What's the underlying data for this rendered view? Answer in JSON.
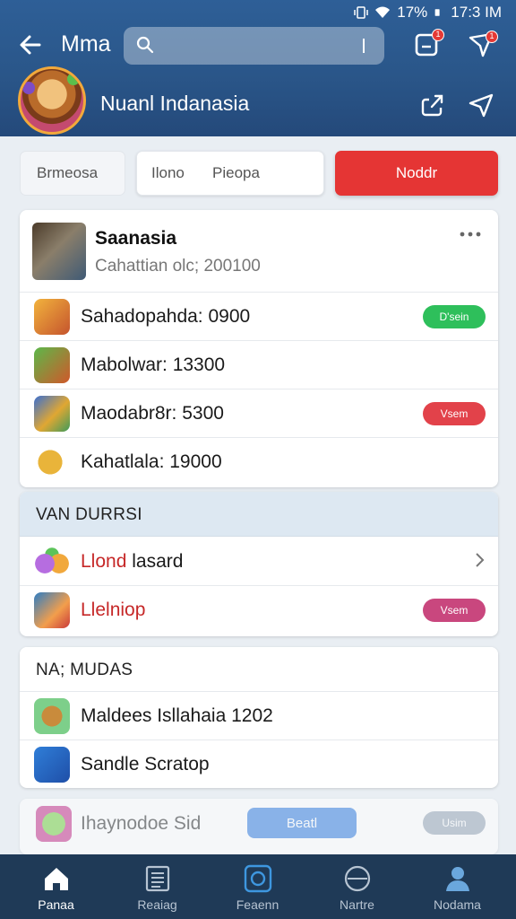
{
  "status_bar": {
    "battery": "17%",
    "time": "17:3 IM"
  },
  "header": {
    "title": "Mma",
    "search": {
      "value": "",
      "placeholder": ""
    },
    "notification_badge": "1",
    "send_badge": "1"
  },
  "profile": {
    "name": "Nuanl Indanasia"
  },
  "tabs": [
    {
      "label": "Brmeosa"
    },
    {
      "label_a": "Ilono",
      "label_b": "Pieopa"
    },
    {
      "label": "Noddr"
    }
  ],
  "feature": {
    "title": "Saanasia",
    "subtitle": "Cahattian olc; 200100"
  },
  "list_1": [
    {
      "text": "Sahadopahda: 0900",
      "pill": "D'sein",
      "pill_color": "#2ebf5b"
    },
    {
      "text": "Mabolwar: 13300",
      "pill": "",
      "pill_color": ""
    },
    {
      "text": "Maodabr8r: 5300",
      "pill": "Vsem",
      "pill_color": "#e2424a"
    },
    {
      "text": "Kahatlala: 19000",
      "pill": "",
      "pill_color": ""
    }
  ],
  "section_2": {
    "title": "VAN DURRSI",
    "rows": [
      {
        "text_a": "Llond",
        "text_b": "lasard"
      },
      {
        "text": "Llelniop",
        "pill": "Vsem",
        "pill_color": "#c9477e"
      }
    ]
  },
  "section_3": {
    "title": "NA; MUDAS",
    "rows": [
      {
        "text": "Maldees Isllahaia 1202"
      },
      {
        "text": "Sandle Scratop"
      }
    ]
  },
  "promo": {
    "text": "Ihaynodoe Sid",
    "button": "Beatl",
    "pill": "Usim"
  },
  "bottom_nav": [
    {
      "label": "Panaa"
    },
    {
      "label": "Reaiag"
    },
    {
      "label": "Feaenn"
    },
    {
      "label": "Nartre"
    },
    {
      "label": "Nodama"
    }
  ],
  "colors": {
    "header": "#2a5689",
    "accent_red": "#e53534",
    "nav": "#1f3a57"
  }
}
